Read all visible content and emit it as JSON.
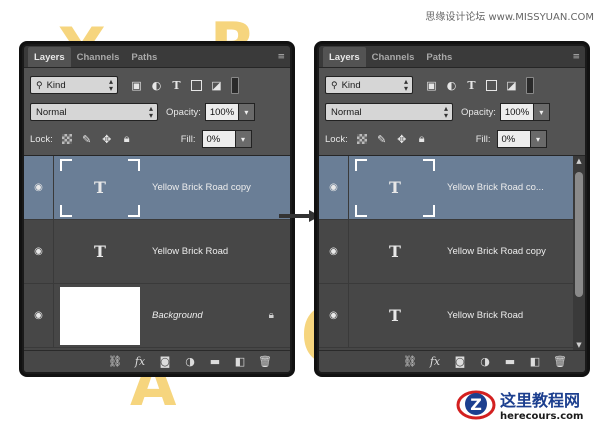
{
  "watermark": "思缘设计论坛 www.MISSYUAN.COM",
  "bg_letters": [
    "Y",
    "R",
    "O",
    "A"
  ],
  "panels": [
    {
      "tabs": [
        "Layers",
        "Channels",
        "Paths"
      ],
      "active_tab": "Layers",
      "filter": {
        "kind_label": "Kind"
      },
      "blend_mode": "Normal",
      "opacity_label": "Opacity:",
      "opacity_value": "100%",
      "lock_label": "Lock:",
      "fill_label": "Fill:",
      "fill_value": "0%",
      "layers": [
        {
          "name": "Yellow Brick Road copy",
          "type": "text",
          "selected": true,
          "thumb": "T"
        },
        {
          "name": "Yellow Brick Road",
          "type": "text",
          "selected": false,
          "thumb": "T"
        },
        {
          "name": "Background",
          "type": "background",
          "selected": false,
          "locked": true
        }
      ]
    },
    {
      "tabs": [
        "Layers",
        "Channels",
        "Paths"
      ],
      "active_tab": "Layers",
      "filter": {
        "kind_label": "Kind"
      },
      "blend_mode": "Normal",
      "opacity_label": "Opacity:",
      "opacity_value": "100%",
      "lock_label": "Lock:",
      "fill_label": "Fill:",
      "fill_value": "0%",
      "layers": [
        {
          "name": "Yellow Brick Road co...",
          "type": "text",
          "selected": true,
          "thumb": "T"
        },
        {
          "name": "Yellow Brick Road copy",
          "type": "text",
          "selected": false,
          "thumb": "T"
        },
        {
          "name": "Yellow Brick Road",
          "type": "text",
          "selected": false,
          "thumb": "T"
        }
      ]
    }
  ],
  "footer_icons": [
    "link-icon",
    "fx-icon",
    "mask-icon",
    "adjustment-icon",
    "folder-icon",
    "new-layer-icon",
    "trash-icon"
  ],
  "fx_label": "fx",
  "logo": {
    "cn": "这里教程网",
    "url": "herecours.com",
    "mark": "Z"
  },
  "colors": {
    "selected_layer": "#6a7e96",
    "panel_bg": "#535353",
    "bg_letters": "#f6d57e"
  }
}
